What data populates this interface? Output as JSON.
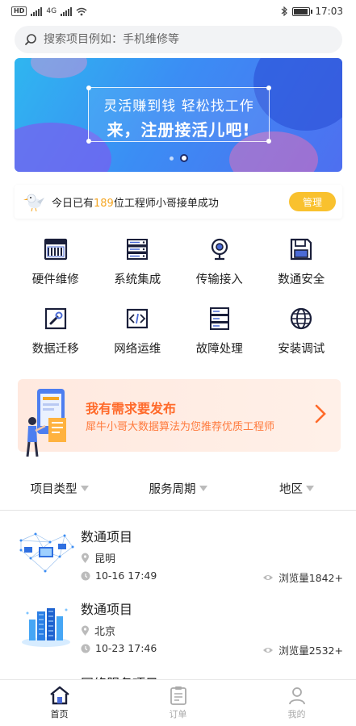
{
  "status_bar": {
    "network_badge": "HD",
    "network_type": "4G",
    "time": "17:03",
    "battery_level": 0.85
  },
  "search": {
    "placeholder": "搜索项目例如：手机维修等"
  },
  "banner": {
    "line1": "灵活赚到钱 轻松找工作",
    "line2": "来，注册接活儿吧!",
    "page_count": 2,
    "active_page": 2
  },
  "notice": {
    "prefix": "今日已有",
    "count": "189",
    "suffix": "位工程师小哥接单成功",
    "button_label": "管理"
  },
  "services": [
    {
      "label": "硬件维修",
      "icon": "hardware-repair-icon"
    },
    {
      "label": "系统集成",
      "icon": "server-rack-icon"
    },
    {
      "label": "传输接入",
      "icon": "webcam-icon"
    },
    {
      "label": "数通安全",
      "icon": "floppy-disk-icon"
    },
    {
      "label": "数据迁移",
      "icon": "wrench-icon"
    },
    {
      "label": "网络运维",
      "icon": "code-icon"
    },
    {
      "label": "故障处理",
      "icon": "server-fault-icon"
    },
    {
      "label": "安装调试",
      "icon": "globe-icon"
    }
  ],
  "promo": {
    "title": "我有需求要发布",
    "subtitle": "犀牛小哥大数据算法为您推荐优质工程师"
  },
  "filters": [
    {
      "label": "项目类型"
    },
    {
      "label": "服务周期"
    },
    {
      "label": "地区"
    }
  ],
  "projects": [
    {
      "title": "数通项目",
      "location": "昆明",
      "time": "10-16 17:49",
      "views": "浏览量1842+"
    },
    {
      "title": "数通项目",
      "location": "北京",
      "time": "10-23 17:46",
      "views": "浏览量2532+"
    }
  ],
  "partial_project_title": "网络服务项目",
  "tabs": [
    {
      "label": "首页",
      "icon": "home-icon",
      "active": true
    },
    {
      "label": "订单",
      "icon": "clipboard-icon",
      "active": false
    },
    {
      "label": "我的",
      "icon": "user-icon",
      "active": false
    }
  ],
  "colors": {
    "accent_yellow": "#f9c12e",
    "highlight": "#f5a623",
    "promo_orange": "#ff6a2a"
  }
}
